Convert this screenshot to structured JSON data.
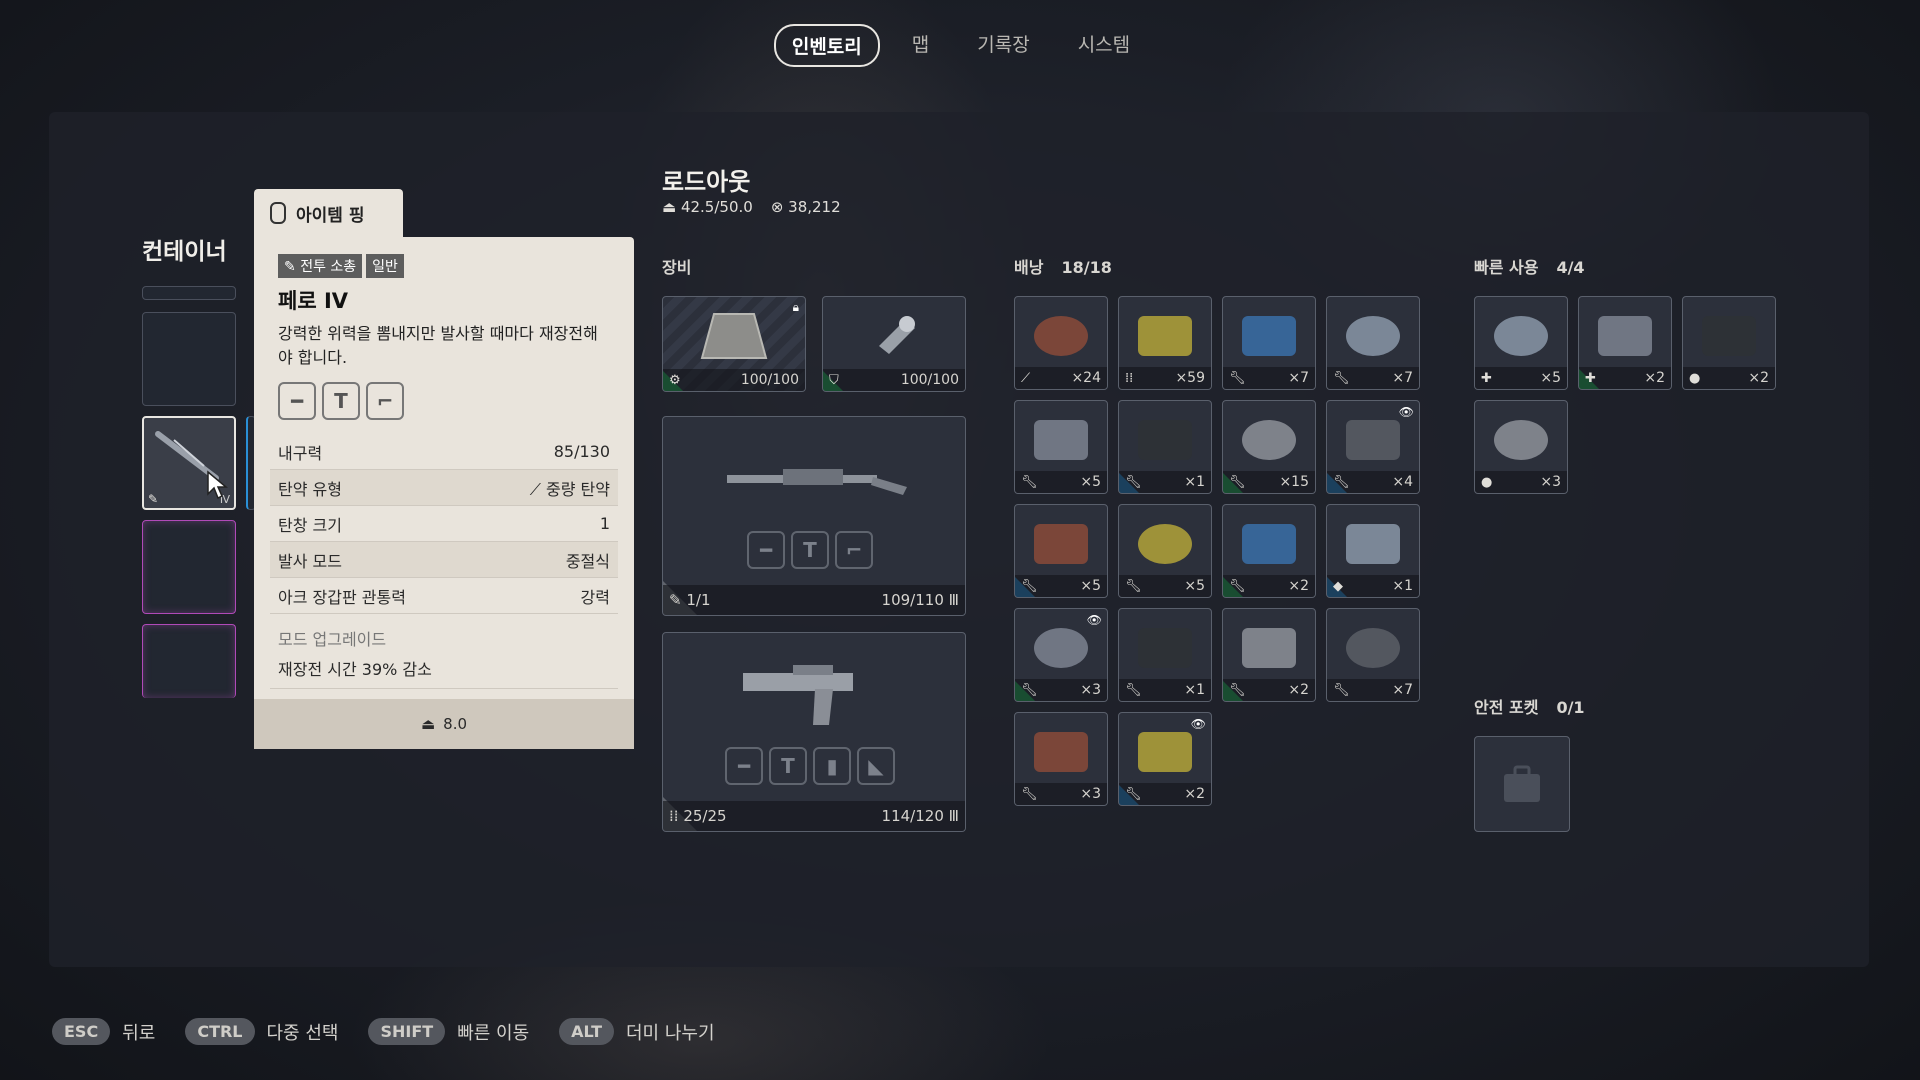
{
  "tabs": [
    "인벤토리",
    "맵",
    "기록장",
    "시스템"
  ],
  "container": {
    "title": "컨테이너"
  },
  "ping": {
    "label": "아이템 핑"
  },
  "tooltip": {
    "tags": [
      "전투 소총",
      "일반"
    ],
    "name": "페로 IV",
    "description": "강력한 위력을 뽐내지만 발사할 때마다 재장전해야 합니다.",
    "stats": [
      {
        "label": "내구력",
        "value": "85/130"
      },
      {
        "label": "탄약 유형",
        "value": "중량 탄약"
      },
      {
        "label": "탄창 크기",
        "value": "1"
      },
      {
        "label": "발사 모드",
        "value": "중절식"
      },
      {
        "label": "아크 장갑판 관통력",
        "value": "강력"
      }
    ],
    "mod_upgrade_title": "모드 업그레이드",
    "mod_upgrade_value": "재장전 시간 39% 감소",
    "weight": "8.0"
  },
  "loadout": {
    "title": "로드아웃",
    "weight": "42.5/50.0",
    "credits": "38,212",
    "equipment_title": "장비",
    "shield_durability": "100/100",
    "augment_durability": "100/100",
    "weapon1": {
      "ammo": "1/1",
      "durability": "109/110"
    },
    "weapon2": {
      "ammo": "25/25",
      "durability": "114/120"
    }
  },
  "backpack": {
    "title": "배낭",
    "count": "18/18",
    "items": [
      {
        "name": "item-1",
        "qty": "×24",
        "rarity": "none",
        "tag": "ammo-heavy"
      },
      {
        "name": "item-2",
        "qty": "×59",
        "rarity": "none",
        "tag": "ammo-light"
      },
      {
        "name": "item-3",
        "qty": "×7",
        "rarity": "none",
        "tag": "wrench"
      },
      {
        "name": "item-4",
        "qty": "×7",
        "rarity": "none",
        "tag": "wrench"
      },
      {
        "name": "item-5",
        "qty": "×5",
        "rarity": "none",
        "tag": "wrench"
      },
      {
        "name": "item-6",
        "qty": "×1",
        "rarity": "blue",
        "tag": "wrench"
      },
      {
        "name": "item-7",
        "qty": "×15",
        "rarity": "green",
        "tag": "wrench"
      },
      {
        "name": "item-8",
        "qty": "×4",
        "rarity": "blue",
        "tag": "wrench",
        "watched": true
      },
      {
        "name": "item-9",
        "qty": "×5",
        "rarity": "blue",
        "tag": "wrench"
      },
      {
        "name": "item-10",
        "qty": "×5",
        "rarity": "none",
        "tag": "wrench"
      },
      {
        "name": "item-11",
        "qty": "×2",
        "rarity": "green",
        "tag": "wrench"
      },
      {
        "name": "item-12",
        "qty": "×1",
        "rarity": "blue",
        "tag": "gem"
      },
      {
        "name": "item-13",
        "qty": "×3",
        "rarity": "green",
        "tag": "wrench",
        "watched": true
      },
      {
        "name": "item-14",
        "qty": "×1",
        "rarity": "none",
        "tag": "wrench"
      },
      {
        "name": "item-15",
        "qty": "×2",
        "rarity": "green",
        "tag": "wrench"
      },
      {
        "name": "item-16",
        "qty": "×7",
        "rarity": "none",
        "tag": "wrench"
      },
      {
        "name": "item-17",
        "qty": "×3",
        "rarity": "none",
        "tag": "wrench"
      },
      {
        "name": "item-18",
        "qty": "×2",
        "rarity": "blue",
        "tag": "wrench",
        "watched": true
      }
    ]
  },
  "quickuse": {
    "title": "빠른 사용",
    "count": "4/4",
    "items": [
      {
        "qty": "×5",
        "rarity": "none",
        "tag": "heal"
      },
      {
        "qty": "×2",
        "rarity": "green",
        "tag": "heal"
      },
      {
        "qty": "×2",
        "rarity": "none",
        "tag": "grenade"
      },
      {
        "qty": "×3",
        "rarity": "none",
        "tag": "grenade"
      }
    ]
  },
  "safe_pocket": {
    "title": "안전 포켓",
    "count": "0/1"
  },
  "hints": [
    {
      "key": "ESC",
      "label": "뒤로"
    },
    {
      "key": "CTRL",
      "label": "다중 선택"
    },
    {
      "key": "SHIFT",
      "label": "빠른 이동"
    },
    {
      "key": "ALT",
      "label": "더미 나누기"
    }
  ],
  "colors": {
    "green": "#23b45a",
    "blue": "#2a8fd6",
    "pink": "#b04ab8",
    "tooltip_bg": "#e9e4dc"
  }
}
